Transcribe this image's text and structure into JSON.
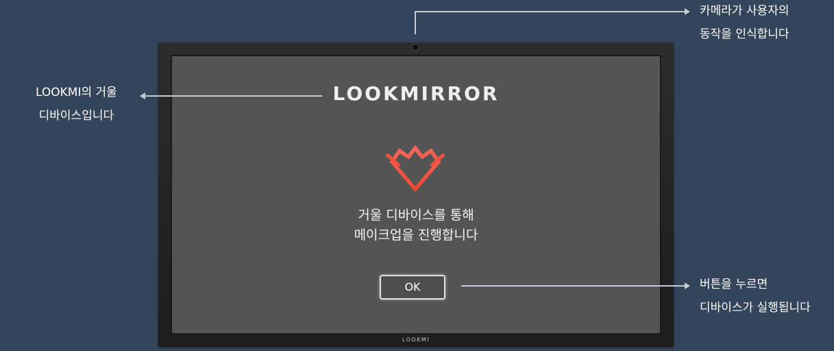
{
  "annotations": {
    "camera": {
      "line1": "카메라가 사용자의",
      "line2": "동작을 인식합니다"
    },
    "device": {
      "line1": "LOOKMI의 거울",
      "line2": "디바이스입니다"
    },
    "button": {
      "line1": "버튼을 누르면",
      "line2": "디바이스가 실행됩니다"
    }
  },
  "screen": {
    "brand_title": "LOOKMIRROR",
    "message_line1": "거울 디바이스를 통해",
    "message_line2": "메이크업을 진행합니다",
    "ok_label": "OK"
  },
  "bezel": {
    "brand": "LOOKMI"
  },
  "icons": {
    "logo": "heart-logo-icon",
    "camera": "camera-icon",
    "arrows": "arrow-right-icon / arrow-left-icon"
  },
  "colors": {
    "background": "#34445a",
    "screen": "#545454",
    "frame": "#232323",
    "logo_red": "#f0533d",
    "text": "#ffffff",
    "connector": "#c7cdd6"
  }
}
